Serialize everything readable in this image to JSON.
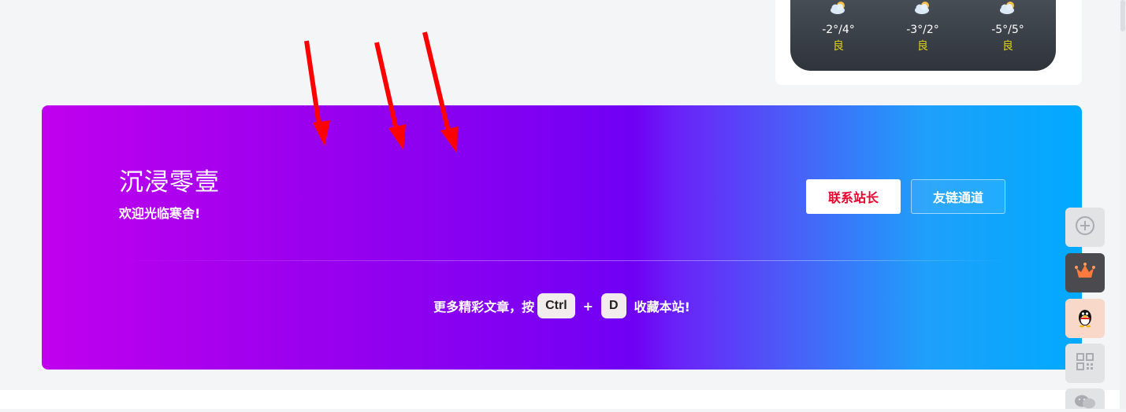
{
  "weather": {
    "days": [
      {
        "icon": "cloud-sun-icon",
        "temp": "-2°/4°",
        "aqi": "良"
      },
      {
        "icon": "cloud-sun-icon",
        "temp": "-3°/2°",
        "aqi": "良"
      },
      {
        "icon": "cloud-sun-icon",
        "temp": "-5°/5°",
        "aqi": "良"
      }
    ]
  },
  "banner": {
    "title": "沉浸零壹",
    "subtitle": "欢迎光临寒舍!",
    "contact_label": "联系站长",
    "friends_label": "友链通道",
    "bookmark_prefix": "更多精彩文章，按",
    "key1": "Ctrl",
    "plus": "+",
    "key2": "D",
    "bookmark_suffix": "收藏本站!"
  },
  "floating": [
    {
      "icon": "add-circle-icon"
    },
    {
      "icon": "crown-icon"
    },
    {
      "icon": "qq-penguin-icon"
    },
    {
      "icon": "qrcode-icon"
    },
    {
      "icon": "wechat-icon"
    }
  ],
  "colors": {
    "contact_text": "#e8002b",
    "aqi": "#e0d312",
    "arrow": "#ff0000"
  }
}
